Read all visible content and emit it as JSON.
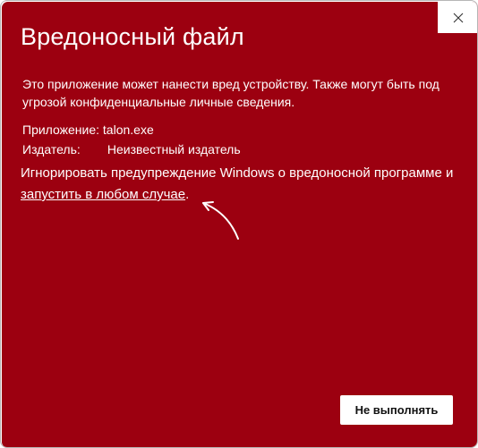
{
  "dialog": {
    "title": "Вредоносный файл",
    "description": "Это приложение может нанести вред устройству. Также могут быть под угрозой конфиденциальные личные сведения.",
    "app_label": "Приложение:",
    "app_value": "talon.exe",
    "publisher_label": "Издатель:",
    "publisher_value": "Неизвестный издатель",
    "ignore_text_prefix": "Игнорировать предупреждение Windows о вредоносной программе и ",
    "run_anyway_link": "запустить в любом случае",
    "ignore_text_suffix": ".",
    "dont_run_button": "Не выполнять"
  },
  "icons": {
    "close": "close-icon",
    "annotation_arrow": "arrow-icon"
  },
  "colors": {
    "panel_background": "#9c0010",
    "text": "#ffffff",
    "button_background": "#ffffff"
  }
}
